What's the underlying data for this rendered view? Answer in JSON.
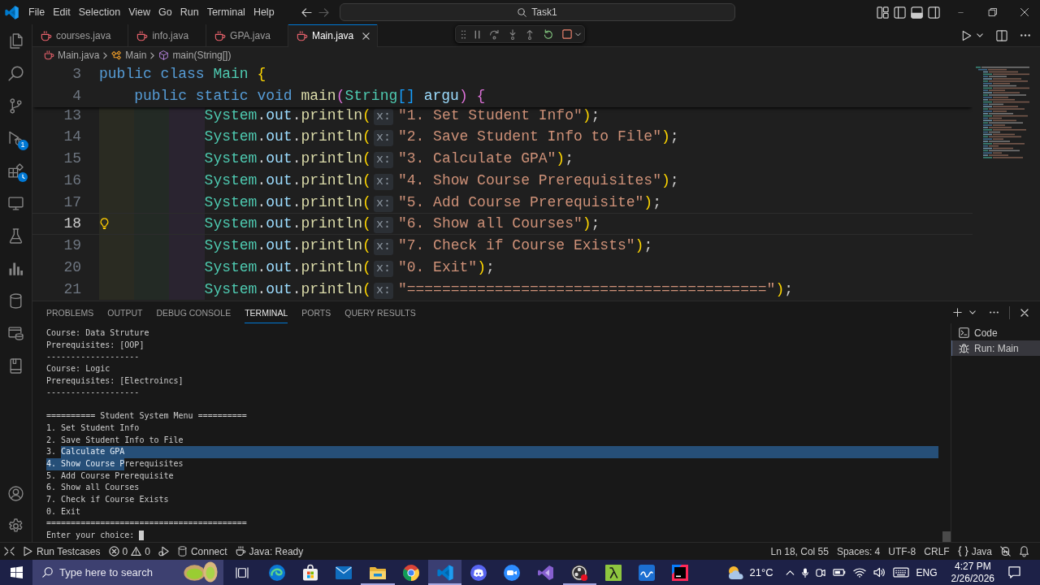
{
  "title_bar": {
    "menu": [
      "File",
      "Edit",
      "Selection",
      "View",
      "Go",
      "Run",
      "Terminal",
      "Help"
    ],
    "command_center": "Task1"
  },
  "activity_bar": {
    "debug_badge": "1"
  },
  "tabs": [
    {
      "label": "courses.java",
      "selected": false
    },
    {
      "label": "info.java",
      "selected": false
    },
    {
      "label": "GPA.java",
      "selected": false
    },
    {
      "label": "Main.java",
      "selected": true
    }
  ],
  "breadcrumb": [
    {
      "kind": "file",
      "text": "Main.java"
    },
    {
      "kind": "class",
      "text": "Main"
    },
    {
      "kind": "method",
      "text": "main(String[])"
    }
  ],
  "editor": {
    "sticky_lines": [
      {
        "number": "3",
        "kind": "class",
        "tokens": [
          {
            "kind": "keyword",
            "text": "public class "
          },
          {
            "kind": "type",
            "text": "Main "
          },
          {
            "kind": "bracket",
            "text": "{"
          }
        ]
      },
      {
        "number": "4",
        "kind": "method",
        "tokens": [
          {
            "kind": "keyword",
            "text": "public static void "
          },
          {
            "kind": "function",
            "text": "main"
          },
          {
            "kind": "bracket2",
            "text": "("
          },
          {
            "kind": "type",
            "text": "String"
          },
          {
            "kind": "bracket3",
            "text": "[] "
          },
          {
            "kind": "param",
            "text": "argu"
          },
          {
            "kind": "bracket2",
            "text": ") {"
          }
        ]
      }
    ],
    "lines": [
      {
        "number": "13",
        "kind": "statement",
        "current": false,
        "tokens": [
          {
            "kind": "type",
            "text": "System"
          },
          {
            "kind": "plain",
            "text": "."
          },
          {
            "kind": "variable",
            "text": "out"
          },
          {
            "kind": "plain",
            "text": "."
          },
          {
            "kind": "function",
            "text": "println"
          },
          {
            "kind": "bracket",
            "text": "("
          },
          {
            "kind": "inlay",
            "text": "x:"
          },
          {
            "kind": "string",
            "text": "\"1. Set Student Info\""
          },
          {
            "kind": "bracket",
            "text": ")"
          },
          {
            "kind": "plain",
            "text": ";"
          }
        ]
      },
      {
        "number": "14",
        "kind": "statement",
        "current": false,
        "tokens": [
          {
            "kind": "type",
            "text": "System"
          },
          {
            "kind": "plain",
            "text": "."
          },
          {
            "kind": "variable",
            "text": "out"
          },
          {
            "kind": "plain",
            "text": "."
          },
          {
            "kind": "function",
            "text": "println"
          },
          {
            "kind": "bracket",
            "text": "("
          },
          {
            "kind": "inlay",
            "text": "x:"
          },
          {
            "kind": "string",
            "text": "\"2. Save Student Info to File\""
          },
          {
            "kind": "bracket",
            "text": ")"
          },
          {
            "kind": "plain",
            "text": ";"
          }
        ]
      },
      {
        "number": "15",
        "kind": "statement",
        "current": false,
        "tokens": [
          {
            "kind": "type",
            "text": "System"
          },
          {
            "kind": "plain",
            "text": "."
          },
          {
            "kind": "variable",
            "text": "out"
          },
          {
            "kind": "plain",
            "text": "."
          },
          {
            "kind": "function",
            "text": "println"
          },
          {
            "kind": "bracket",
            "text": "("
          },
          {
            "kind": "inlay",
            "text": "x:"
          },
          {
            "kind": "string",
            "text": "\"3. Calculate GPA\""
          },
          {
            "kind": "bracket",
            "text": ")"
          },
          {
            "kind": "plain",
            "text": ";"
          }
        ]
      },
      {
        "number": "16",
        "kind": "statement",
        "current": false,
        "tokens": [
          {
            "kind": "type",
            "text": "System"
          },
          {
            "kind": "plain",
            "text": "."
          },
          {
            "kind": "variable",
            "text": "out"
          },
          {
            "kind": "plain",
            "text": "."
          },
          {
            "kind": "function",
            "text": "println"
          },
          {
            "kind": "bracket",
            "text": "("
          },
          {
            "kind": "inlay",
            "text": "x:"
          },
          {
            "kind": "string",
            "text": "\"4. Show Course Prerequisites\""
          },
          {
            "kind": "bracket",
            "text": ")"
          },
          {
            "kind": "plain",
            "text": ";"
          }
        ]
      },
      {
        "number": "17",
        "kind": "statement",
        "current": false,
        "tokens": [
          {
            "kind": "type",
            "text": "System"
          },
          {
            "kind": "plain",
            "text": "."
          },
          {
            "kind": "variable",
            "text": "out"
          },
          {
            "kind": "plain",
            "text": "."
          },
          {
            "kind": "function",
            "text": "println"
          },
          {
            "kind": "bracket",
            "text": "("
          },
          {
            "kind": "inlay",
            "text": "x:"
          },
          {
            "kind": "string",
            "text": "\"5. Add Course Prerequisite\""
          },
          {
            "kind": "bracket",
            "text": ")"
          },
          {
            "kind": "plain",
            "text": ";"
          }
        ]
      },
      {
        "number": "18",
        "kind": "statement",
        "current": true,
        "tokens": [
          {
            "kind": "type",
            "text": "System"
          },
          {
            "kind": "plain",
            "text": "."
          },
          {
            "kind": "variable",
            "text": "out"
          },
          {
            "kind": "plain",
            "text": "."
          },
          {
            "kind": "function",
            "text": "println"
          },
          {
            "kind": "bracket",
            "text": "("
          },
          {
            "kind": "inlay",
            "text": "x:"
          },
          {
            "kind": "string",
            "text": "\"6. Show all Courses\""
          },
          {
            "kind": "bracket",
            "text": ")"
          },
          {
            "kind": "plain",
            "text": ";"
          }
        ]
      },
      {
        "number": "19",
        "kind": "statement",
        "current": false,
        "tokens": [
          {
            "kind": "type",
            "text": "System"
          },
          {
            "kind": "plain",
            "text": "."
          },
          {
            "kind": "variable",
            "text": "out"
          },
          {
            "kind": "plain",
            "text": "."
          },
          {
            "kind": "function",
            "text": "println"
          },
          {
            "kind": "bracket",
            "text": "("
          },
          {
            "kind": "inlay",
            "text": "x:"
          },
          {
            "kind": "string",
            "text": "\"7. Check if Course Exists\""
          },
          {
            "kind": "bracket",
            "text": ")"
          },
          {
            "kind": "plain",
            "text": ";"
          }
        ]
      },
      {
        "number": "20",
        "kind": "statement",
        "current": false,
        "tokens": [
          {
            "kind": "type",
            "text": "System"
          },
          {
            "kind": "plain",
            "text": "."
          },
          {
            "kind": "variable",
            "text": "out"
          },
          {
            "kind": "plain",
            "text": "."
          },
          {
            "kind": "function",
            "text": "println"
          },
          {
            "kind": "bracket",
            "text": "("
          },
          {
            "kind": "inlay",
            "text": "x:"
          },
          {
            "kind": "string",
            "text": "\"0. Exit\""
          },
          {
            "kind": "bracket",
            "text": ")"
          },
          {
            "kind": "plain",
            "text": ";"
          }
        ]
      },
      {
        "number": "21",
        "kind": "statement",
        "current": false,
        "tokens": [
          {
            "kind": "type",
            "text": "System"
          },
          {
            "kind": "plain",
            "text": "."
          },
          {
            "kind": "variable",
            "text": "out"
          },
          {
            "kind": "plain",
            "text": "."
          },
          {
            "kind": "function",
            "text": "println"
          },
          {
            "kind": "bracket",
            "text": "("
          },
          {
            "kind": "inlay",
            "text": "x:"
          },
          {
            "kind": "string",
            "text": "\"=========================================\""
          },
          {
            "kind": "bracket",
            "text": ")"
          },
          {
            "kind": "plain",
            "text": ";"
          }
        ]
      }
    ]
  },
  "panel": {
    "tabs": [
      {
        "label": "PROBLEMS",
        "selected": false
      },
      {
        "label": "OUTPUT",
        "selected": false
      },
      {
        "label": "DEBUG CONSOLE",
        "selected": false
      },
      {
        "label": "TERMINAL",
        "selected": true
      },
      {
        "label": "PORTS",
        "selected": false
      },
      {
        "label": "QUERY RESULTS",
        "selected": false
      }
    ],
    "terminal": {
      "blocks": [
        {
          "lines": [
            {
              "parts": [
                {
                  "text": "Course: Data Struture",
                  "selected": false
                }
              ]
            },
            {
              "parts": [
                {
                  "text": "Prerequisites: [OOP]",
                  "selected": false
                }
              ]
            },
            {
              "parts": [
                {
                  "text": "-------------------",
                  "selected": false
                }
              ]
            },
            {
              "parts": [
                {
                  "text": "Course: Logic",
                  "selected": false
                }
              ]
            },
            {
              "parts": [
                {
                  "text": "Prerequisites: [Electroincs]",
                  "selected": false
                }
              ]
            },
            {
              "parts": [
                {
                  "text": "-------------------",
                  "selected": false
                }
              ]
            }
          ]
        },
        {
          "lines": [
            {
              "parts": [
                {
                  "text": "========== Student System Menu ==========",
                  "selected": false
                }
              ]
            },
            {
              "parts": [
                {
                  "text": "1. Set Student Info",
                  "selected": false
                }
              ]
            },
            {
              "parts": [
                {
                  "text": "2. Save Student Info to File",
                  "selected": false
                }
              ]
            },
            {
              "parts": [
                {
                  "text": "3. ",
                  "selected": false
                },
                {
                  "text": "Calculate GPA",
                  "selected": true
                }
              ]
            },
            {
              "parts": [
                {
                  "text": "4. Show Course P",
                  "selected": true
                },
                {
                  "text": "rerequisites",
                  "selected": false
                }
              ]
            },
            {
              "parts": [
                {
                  "text": "5. Add Course Prerequisite",
                  "selected": false
                }
              ]
            },
            {
              "parts": [
                {
                  "text": "6. Show all Courses",
                  "selected": false
                }
              ]
            },
            {
              "parts": [
                {
                  "text": "7. Check if Course Exists",
                  "selected": false
                }
              ]
            },
            {
              "parts": [
                {
                  "text": "0. Exit",
                  "selected": false
                }
              ]
            },
            {
              "parts": [
                {
                  "text": "=========================================",
                  "selected": false
                }
              ]
            }
          ]
        }
      ],
      "prompt": {
        "text": "Enter your choice: ",
        "cursor": true
      }
    },
    "terminals": [
      {
        "kind": "shell",
        "label": "Code",
        "selected": false
      },
      {
        "kind": "debug",
        "label": "Run: Main",
        "selected": true
      }
    ]
  },
  "status_bar": {
    "left": [
      {
        "kind": "remote"
      },
      {
        "kind": "run",
        "text": "Run Testcases"
      },
      {
        "kind": "problems",
        "errors": "0",
        "warnings": "0"
      },
      {
        "kind": "debug"
      },
      {
        "kind": "database",
        "text": "Connect"
      },
      {
        "kind": "java",
        "text": "Java: Ready"
      }
    ],
    "right": [
      {
        "kind": "text",
        "text": "Ln 18, Col 55"
      },
      {
        "kind": "text",
        "text": "Spaces: 4"
      },
      {
        "kind": "text",
        "text": "UTF-8"
      },
      {
        "kind": "text",
        "text": "CRLF"
      },
      {
        "kind": "language",
        "text": "Java"
      },
      {
        "kind": "copilot"
      },
      {
        "kind": "bell"
      }
    ]
  },
  "taskbar": {
    "search": {
      "placeholder": "Type here to search"
    },
    "apps": [
      {
        "running": false,
        "selected": false
      },
      {
        "running": false,
        "selected": false
      },
      {
        "running": false,
        "selected": false
      },
      {
        "running": true,
        "selected": false
      },
      {
        "running": false,
        "selected": false
      },
      {
        "running": true,
        "selected": true
      },
      {
        "running": false,
        "selected": false
      },
      {
        "running": false,
        "selected": false
      },
      {
        "running": false,
        "selected": false
      },
      {
        "running": true,
        "selected": false
      },
      {
        "running": false,
        "selected": false
      },
      {
        "running": false,
        "selected": false
      },
      {
        "running": false,
        "selected": false
      }
    ],
    "weather": "21°C",
    "language": "ENG",
    "time": "4:27 PM",
    "date": "2/26/2026"
  }
}
